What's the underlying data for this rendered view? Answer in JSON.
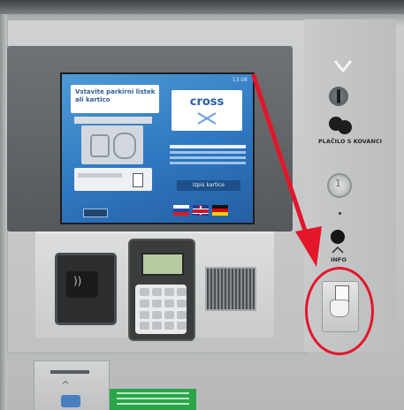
{
  "screen": {
    "clock": "13:08",
    "prompt": "Vstavite parkirni listek ali kartico",
    "brand_logo": "cross",
    "primary_button": "Izpis kartice"
  },
  "panel": {
    "coins_label": "PLAČILO S KOVANCI",
    "info_label": "INFO"
  },
  "annotations": {
    "arrow_color": "#e4162a",
    "circle_color": "#e4162a"
  }
}
